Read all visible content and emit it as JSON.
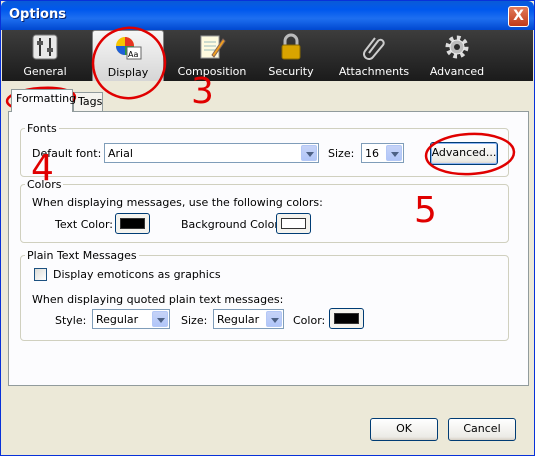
{
  "window": {
    "title": "Options",
    "close": "X"
  },
  "toolbar": {
    "items": [
      {
        "label": "General",
        "icon": "sliders-icon"
      },
      {
        "label": "Display",
        "icon": "color-wheel-icon"
      },
      {
        "label": "Composition",
        "icon": "notepad-pencil-icon"
      },
      {
        "label": "Security",
        "icon": "padlock-icon"
      },
      {
        "label": "Attachments",
        "icon": "paperclip-icon"
      },
      {
        "label": "Advanced",
        "icon": "gear-icon"
      }
    ],
    "selected": "Display"
  },
  "tabs": [
    {
      "label": "Formatting",
      "active": true
    },
    {
      "label": "Tags",
      "active": false
    }
  ],
  "fonts": {
    "legend": "Fonts",
    "default_font_label": "Default font:",
    "default_font_value": "Arial",
    "size_label": "Size:",
    "size_value": "16",
    "advanced_button": "Advanced..."
  },
  "colors": {
    "legend": "Colors",
    "intro": "When displaying messages, use the following colors:",
    "text_color_label": "Text Color:",
    "text_color": "#000000",
    "background_color_label": "Background Color:",
    "background_color": "#ffffff"
  },
  "plain_text": {
    "legend": "Plain Text Messages",
    "emoticons_label": "Display emoticons as graphics",
    "emoticons_checked": false,
    "quoted_intro": "When displaying quoted plain text messages:",
    "style_label": "Style:",
    "style_value": "Regular",
    "size_label": "Size:",
    "size_value": "Regular",
    "color_label": "Color:",
    "color": "#000000"
  },
  "buttons": {
    "ok": "OK",
    "cancel": "Cancel"
  },
  "annotations": {
    "numbers": [
      "3",
      "4",
      "5"
    ],
    "color": "#e00000"
  }
}
